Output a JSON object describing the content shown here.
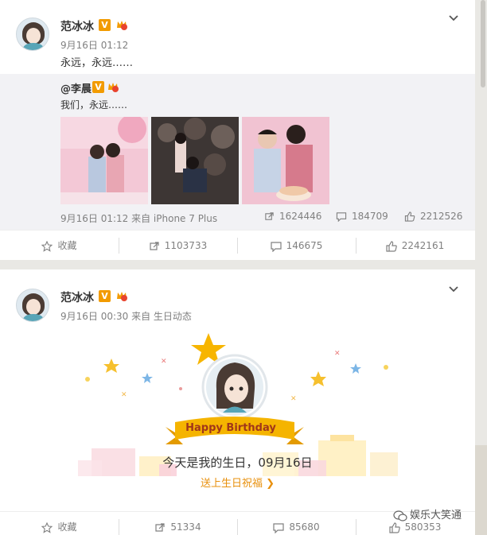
{
  "post1": {
    "author": "范冰冰",
    "v_badge": "V",
    "time": "9月16日 01:12",
    "text": "永远，永远……",
    "repost": {
      "author": "@李晨",
      "v_badge": "V",
      "text": "我们，永远……",
      "meta": "9月16日 01:12 来自 iPhone 7 Plus",
      "repost_count": "1624446",
      "comment_count": "184709",
      "like_count": "2212526"
    },
    "actions": {
      "favorite": "收藏",
      "repost": "1103733",
      "comment": "146675",
      "like": "2242161"
    }
  },
  "post2": {
    "author": "范冰冰",
    "v_badge": "V",
    "meta": "9月16日 00:30 来自 生日动态",
    "banner_label": "Happy Birthday",
    "birthday_text": "今天是我的生日，09月16日",
    "wish_link": "送上生日祝福 ❯",
    "actions": {
      "favorite": "收藏",
      "repost": "51334",
      "comment": "85680",
      "like": "580353"
    }
  },
  "watermark": "娱乐大笑通",
  "colors": {
    "accent": "#f29b00",
    "link": "#e8900d",
    "ribbon": "#f5b400"
  }
}
